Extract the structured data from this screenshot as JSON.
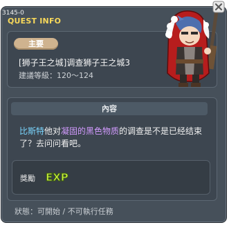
{
  "window": {
    "quest_id": "3145-0",
    "title": "QUEST INFO"
  },
  "header": {
    "badge": "主要",
    "quest_name": "[狮子王之城]调查狮子王之城3",
    "level": "建議等級：120～124"
  },
  "content": {
    "section_title": "內容",
    "description": {
      "npc": "比斯特",
      "part1": "他对",
      "item": "凝固的黑色物质",
      "part2": "的调查是不是已经结束了？去问问看吧。"
    }
  },
  "reward": {
    "label": "獎勵",
    "exp_text": "EXP"
  },
  "status": {
    "text": "狀態：可開始 / 不可執行任務"
  },
  "colors": {
    "title": "#f7d85a",
    "npc_name": "#7ad6ff",
    "item_name": "#d39bff",
    "exp": "#c8f03c"
  }
}
